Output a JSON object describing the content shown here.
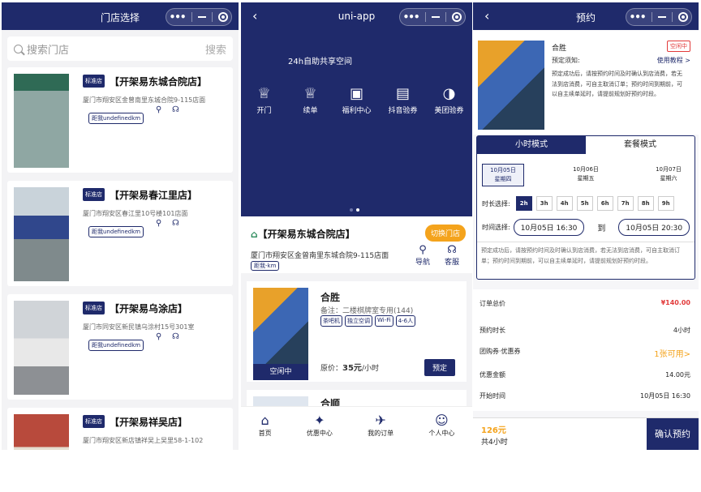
{
  "p1": {
    "title": "门店选择",
    "search_placeholder": "搜索门店",
    "search_btn": "搜索",
    "stores": [
      {
        "tag": "标准店",
        "name": "【开架易东城合院店】",
        "addr": "厦门市翔安区金曾南里东城合院9-115店面",
        "dist": "距我undefinedkm"
      },
      {
        "tag": "标准店",
        "name": "【开架易春江里店】",
        "addr": "厦门市翔安区春江里10号楼101店面",
        "dist": "距我undefinedkm"
      },
      {
        "tag": "标准店",
        "name": "【开架易乌涂店】",
        "addr": "厦门市同安区新民镇乌涂村15号301室",
        "dist": "距我undefinedkm"
      },
      {
        "tag": "标准店",
        "name": "【开架易祥吴店】",
        "addr": "厦门市翔安区新店镇祥吴上吴里58-1-102",
        "dist": ""
      }
    ]
  },
  "p2": {
    "title": "uni-app",
    "slogan": "24h自助共享空间",
    "menu": [
      {
        "label": "开门",
        "icon": "crown-icon"
      },
      {
        "label": "续单",
        "icon": "crown-icon"
      },
      {
        "label": "福利中心",
        "icon": "gift-icon"
      },
      {
        "label": "抖音验券",
        "icon": "coupon-icon"
      },
      {
        "label": "美团验券",
        "icon": "meituan-icon"
      }
    ],
    "shop_name": "【开架易东城合院店】",
    "switch_btn": "切换门店",
    "shop_addr": "厦门市翔安区金曾南里东城合院9-115店面",
    "shop_dist": "距我-km",
    "nav_label": "导航",
    "svc_label": "客服",
    "room": {
      "name": "合胜",
      "remark": "备注：二楼棋牌室专用(144)",
      "tags": [
        "茶吧机",
        "独立空调",
        "Wi-Fi",
        "4-6人"
      ],
      "status": "空闲中",
      "price_label": "原价：",
      "price": "35元",
      "price_unit": "/小时",
      "book": "预定"
    },
    "room2_name": "合顺",
    "tabs": [
      {
        "label": "首页",
        "icon": "home-icon"
      },
      {
        "label": "优惠中心",
        "icon": "discount-icon"
      },
      {
        "label": "我的订单",
        "icon": "order-icon"
      },
      {
        "label": "个人中心",
        "icon": "user-icon"
      }
    ]
  },
  "p3": {
    "title": "预约",
    "room_name": "合胜",
    "status": "空闲中",
    "notice_label": "预定须知:",
    "tutorial": "使用教程 >",
    "notice": "预定成功后，请按预约时间及时确认到店消费，若无法到店消费，可自主取消订单；预约时间到期前，可以自主续单延时，请提前规划好预约时段。",
    "mode_tabs": [
      "小时模式",
      "套餐模式"
    ],
    "dates": [
      {
        "d": "10月05日",
        "w": "星期四"
      },
      {
        "d": "10月06日",
        "w": "星期五"
      },
      {
        "d": "10月07日",
        "w": "星期六"
      }
    ],
    "dur_label": "时长选择:",
    "durations": [
      "2h",
      "3h",
      "4h",
      "5h",
      "6h",
      "7h",
      "8h",
      "9h"
    ],
    "time_label": "时间选择:",
    "start": "10月05日 16:30",
    "to": "到",
    "end": "10月05日 20:30",
    "mode_note": "预定成功后，请按预约时间及时确认到店消费，若无法到店消费，可自主取消订单；预约时间到期前，可以自主续单延时，请提前规划好预约时段。",
    "order": [
      {
        "k": "订单总价",
        "v": "¥140.00"
      },
      {
        "k": "预约时长",
        "v": "4小时"
      },
      {
        "k": "团购券·优惠券",
        "v": "1张可用>"
      },
      {
        "k": "优惠金额",
        "v": "14.00元"
      },
      {
        "k": "开始时间",
        "v": "10月05日 16:30"
      }
    ],
    "total": "126元",
    "hours": "共4小时",
    "confirm": "确认预约"
  }
}
